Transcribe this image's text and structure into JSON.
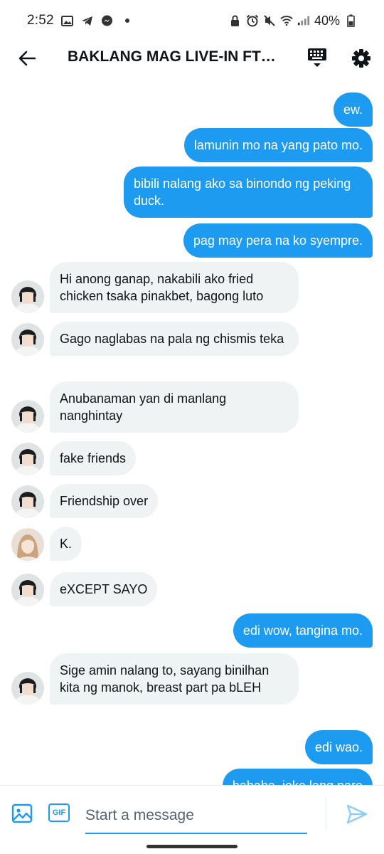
{
  "status_bar": {
    "time": "2:52",
    "battery": "40%",
    "left_icons": [
      "gallery-icon",
      "telegram-icon",
      "messenger-icon",
      "dot-icon"
    ],
    "right_icons": [
      "lock-icon",
      "alarm-icon",
      "mute-icon",
      "wifi-icon",
      "signal-icon",
      "battery-icon"
    ]
  },
  "header": {
    "title": "BAKLANG MAG LIVE-IN FT…",
    "icons": [
      "back-arrow-icon",
      "keyboard-icon",
      "settings-icon"
    ]
  },
  "messages": [
    {
      "dir": "out",
      "text": "ew."
    },
    {
      "dir": "out",
      "text": "lamunin mo na yang pato mo."
    },
    {
      "dir": "out",
      "text": "bibili nalang ako sa binondo ng peking duck."
    },
    {
      "dir": "out",
      "text": "pag may pera na ko syempre."
    },
    {
      "dir": "in",
      "avatar": "short-hair-avatar",
      "text": "Hi anong ganap, nakabili ako fried chicken tsaka pinakbet, bagong luto"
    },
    {
      "dir": "in",
      "avatar": "short-hair-avatar",
      "text": "Gago naglabas na pala ng chismis teka"
    },
    {
      "dir": "in",
      "avatar": "short-hair-avatar",
      "text": "Anubanaman yan di manlang nanghintay"
    },
    {
      "dir": "in",
      "avatar": "short-hair-avatar",
      "text": "fake friends"
    },
    {
      "dir": "in",
      "avatar": "short-hair-avatar",
      "text": "Friendship over"
    },
    {
      "dir": "in",
      "avatar": "blonde-avatar",
      "text": "K."
    },
    {
      "dir": "in",
      "avatar": "short-hair-avatar",
      "text": "eXCEPT SAYO"
    },
    {
      "dir": "out",
      "text": "edi wow, tangina mo."
    },
    {
      "dir": "in",
      "avatar": "short-hair-avatar",
      "text": "Sige amin nalang to, sayang binilhan kita ng manok, breast part pa bLEH"
    },
    {
      "dir": "out",
      "text": "edi wao."
    },
    {
      "dir": "out",
      "text": "hahaha, joke lang pare"
    }
  ],
  "composer": {
    "placeholder": "Start a message",
    "gif_label": "GIF"
  },
  "colors": {
    "accent": "#1d9bf0",
    "incoming_bubble": "#eff3f4",
    "text": "#0f1419"
  }
}
